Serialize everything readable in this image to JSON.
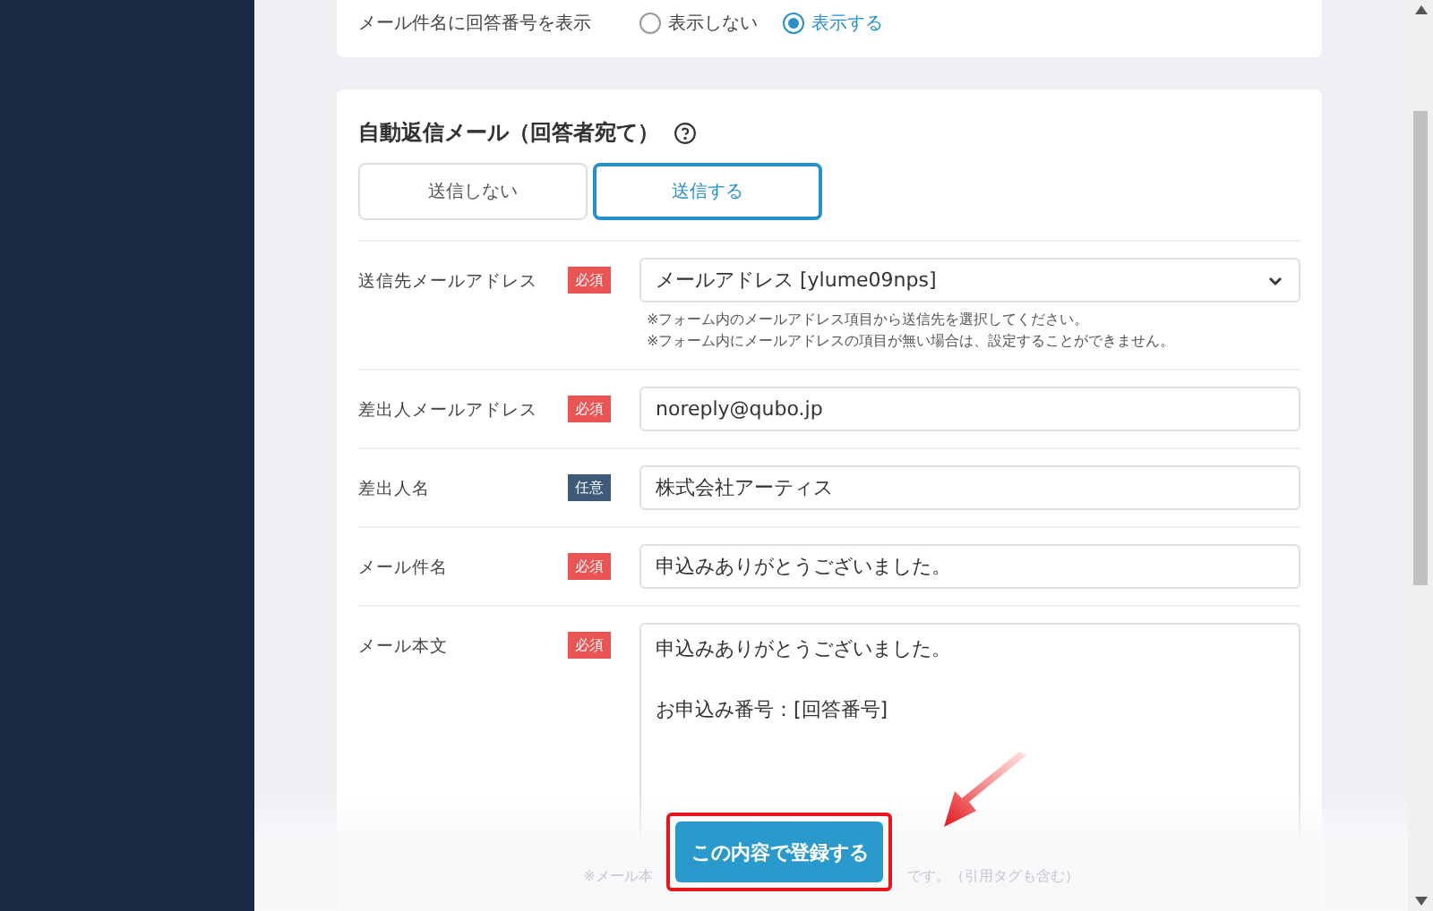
{
  "display_setting": {
    "label": "メール件名に回答番号を表示",
    "options": [
      {
        "label": "表示しない",
        "selected": false
      },
      {
        "label": "表示する",
        "selected": true
      }
    ]
  },
  "auto_reply": {
    "title": "自動返信メール（回答者宛て）",
    "tabs": [
      {
        "label": "送信しない",
        "selected": false
      },
      {
        "label": "送信する",
        "selected": true
      }
    ],
    "rows": [
      {
        "kind": "select",
        "label": "送信先メールアドレス",
        "badge": "必須",
        "required": true,
        "value": "メールアドレス [ylume09nps]",
        "notes": [
          "※フォーム内のメールアドレス項目から送信先を選択してください。",
          "※フォーム内にメールアドレスの項目が無い場合は、設定することができません。"
        ]
      },
      {
        "kind": "input",
        "label": "差出人メールアドレス",
        "badge": "必須",
        "required": true,
        "value": "noreply@qubo.jp"
      },
      {
        "kind": "input",
        "label": "差出人名",
        "badge": "任意",
        "required": false,
        "value": "株式会社アーティス"
      },
      {
        "kind": "input",
        "label": "メール件名",
        "badge": "必須",
        "required": true,
        "value": "申込みありがとうございました。"
      },
      {
        "kind": "textarea",
        "label": "メール本文",
        "badge": "必須",
        "required": true,
        "paragraphs": [
          "申込みありがとうございました。",
          "お申込み番号：[回答番号]"
        ],
        "note_parts": [
          "※メール本",
          "です。（引用タグも含む）"
        ]
      }
    ]
  },
  "submit_button": "この内容で登録する"
}
